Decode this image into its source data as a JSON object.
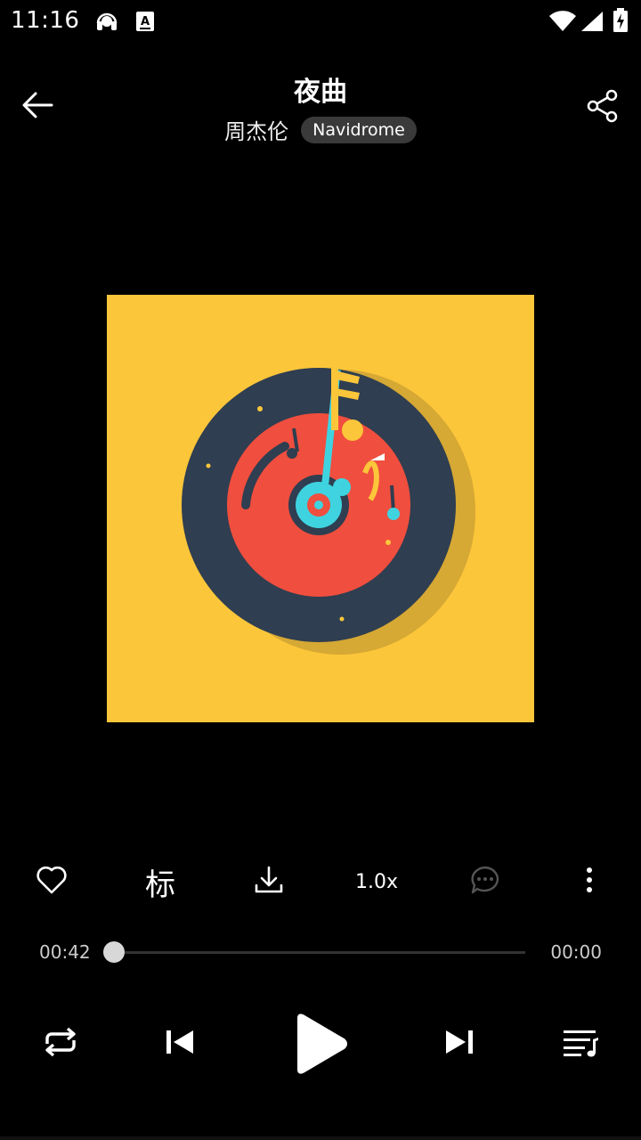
{
  "status_bar": {
    "time": "11:16"
  },
  "header": {
    "title": "夜曲",
    "artist": "周杰伦",
    "source": "Navidrome"
  },
  "actions": {
    "tag_label": "标",
    "speed_label": "1.0x"
  },
  "progress": {
    "current_time": "00:42",
    "total_time": "00:00",
    "played_fraction": 0.0
  },
  "colors": {
    "background": "#000000",
    "album_background": "#fcc63a",
    "record_dark": "#2f3e50",
    "record_red": "#f04e3e",
    "accent_cyan": "#3fd3e0"
  },
  "icons": {
    "status": [
      "headset-icon",
      "keyboard-a-icon",
      "wifi-icon",
      "signal-icon",
      "battery-icon"
    ],
    "header": [
      "back-arrow-icon",
      "share-icon"
    ],
    "actions": [
      "heart-icon",
      "download-icon",
      "comment-icon",
      "more-vertical-icon"
    ],
    "controls": [
      "repeat-icon",
      "skip-previous-icon",
      "play-icon",
      "skip-next-icon",
      "playlist-icon"
    ]
  }
}
